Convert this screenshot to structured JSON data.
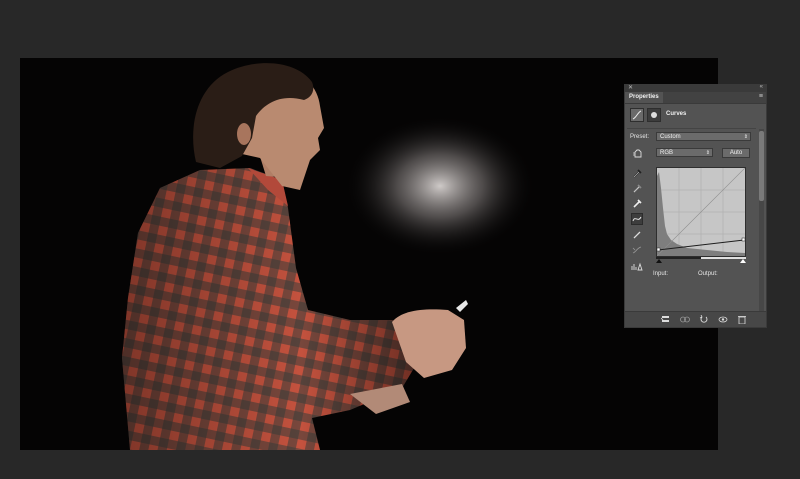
{
  "panel": {
    "tab_label": "Properties",
    "title": "Curves",
    "preset_label": "Preset:",
    "preset_value": "Custom",
    "channel_value": "RGB",
    "auto_label": "Auto",
    "input_label": "Input:",
    "output_label": "Output:"
  },
  "icons": {
    "close": "close-icon",
    "collapse": "double-chevron-icon",
    "panel_menu": "panel-menu-icon",
    "adjustment": "curves-adjustment-icon",
    "mask": "layer-mask-icon",
    "on_image": "hand-adjust-icon",
    "eyedroppers": [
      "black-point-eyedropper-icon",
      "gray-point-eyedropper-icon",
      "white-point-eyedropper-icon"
    ],
    "tools": [
      "curve-edit-icon",
      "pencil-icon",
      "smooth-icon",
      "clipping-warning-icon"
    ],
    "bottom": [
      "clip-to-layer-icon",
      "view-previous-icon",
      "reset-icon",
      "visibility-icon",
      "trash-icon"
    ]
  },
  "colors": {
    "canvas_bg": "#050404",
    "shirt_red": "#c4523e",
    "shirt_dark": "#3b3d3a",
    "panel_bg": "#535353",
    "workspace_bg": "#282828"
  }
}
